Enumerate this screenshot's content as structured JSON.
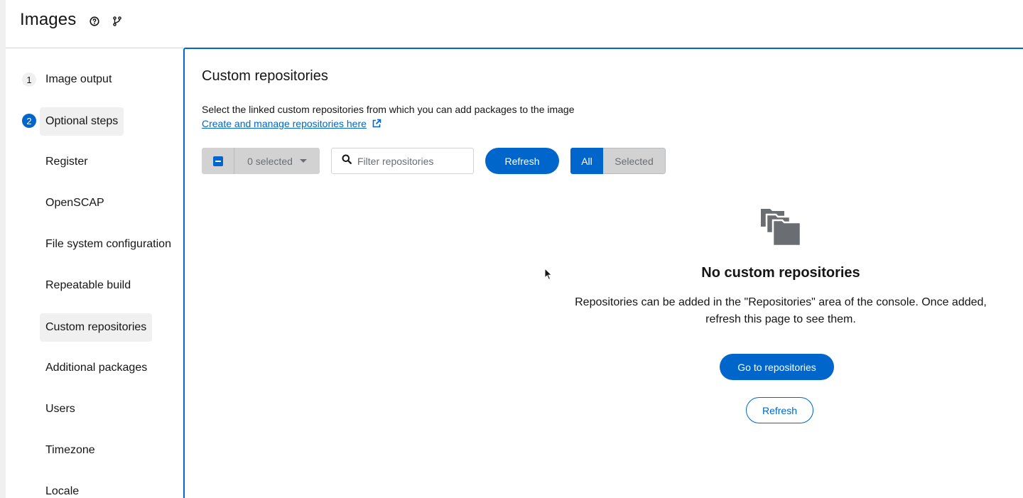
{
  "header": {
    "title": "Images",
    "help_icon": "help-circle-icon",
    "branch_icon": "code-branch-icon"
  },
  "nav": {
    "steps": [
      {
        "number": "1",
        "label": "Image output",
        "state": "default"
      },
      {
        "number": "2",
        "label": "Optional steps",
        "state": "current"
      }
    ],
    "substeps": [
      {
        "label": "Register"
      },
      {
        "label": "OpenSCAP"
      },
      {
        "label": "File system configuration"
      },
      {
        "label": "Repeatable build"
      },
      {
        "label": "Custom repositories",
        "active": true
      },
      {
        "label": "Additional packages"
      },
      {
        "label": "Users"
      },
      {
        "label": "Timezone"
      },
      {
        "label": "Locale"
      }
    ]
  },
  "main": {
    "title": "Custom repositories",
    "description": "Select the linked custom repositories from which you can add packages to the image",
    "manage_link": "Create and manage repositories here",
    "toolbar": {
      "bulk_select_label": "0 selected",
      "filter_placeholder": "Filter repositories",
      "refresh_label": "Refresh",
      "toggle_all": "All",
      "toggle_selected": "Selected",
      "toggle_active": "All"
    },
    "empty_state": {
      "icon": "repository-folders-icon",
      "title": "No custom repositories",
      "body": "Repositories can be added in the \"Repositories\" area of the console. Once added, refresh this page to see them.",
      "primary_action": "Go to repositories",
      "secondary_action": "Refresh"
    }
  },
  "colors": {
    "primary": "#0066cc",
    "active_bg": "#f0f0f0",
    "disabled_bg": "#d2d2d2",
    "text": "#151515",
    "muted_text": "#6a6e73"
  }
}
